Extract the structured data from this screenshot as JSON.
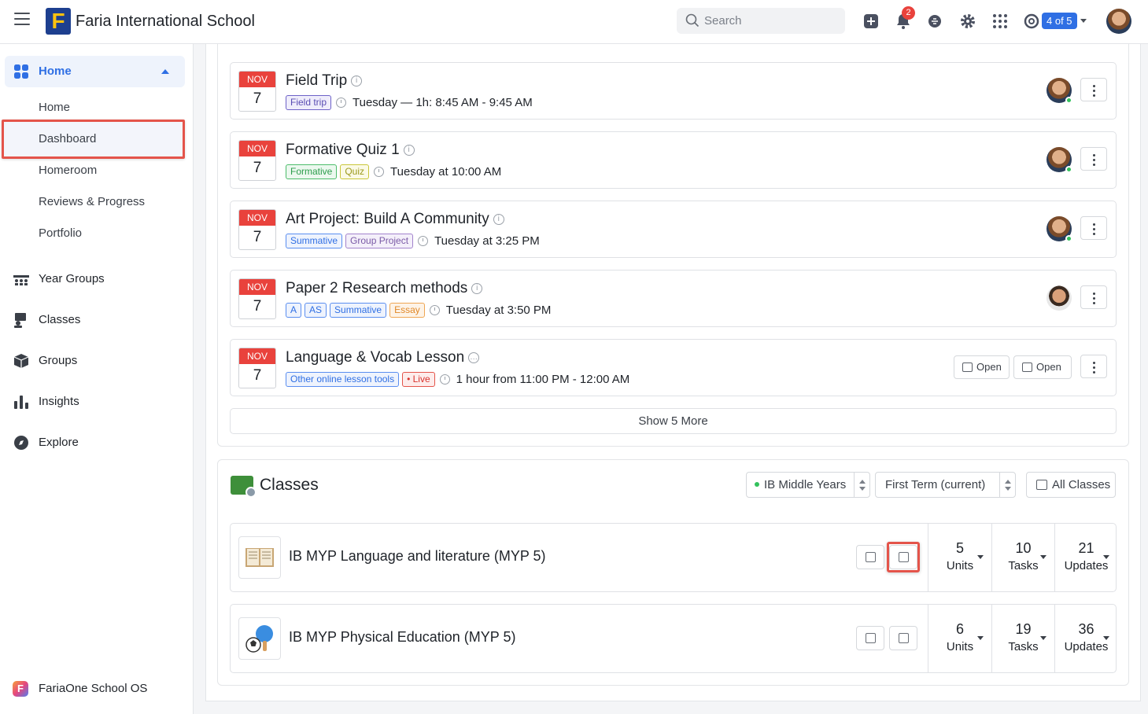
{
  "topbar": {
    "school_name": "Faria International School",
    "logo_letter": "F",
    "search_placeholder": "Search",
    "notification_count": "2",
    "pagination_pill": "4 of 5"
  },
  "sidebar": {
    "home_label": "Home",
    "sub_items": [
      "Home",
      "Dashboard",
      "Homeroom",
      "Reviews & Progress",
      "Portfolio"
    ],
    "nav_items": [
      {
        "label": "Year Groups",
        "icon": "year-groups-icon"
      },
      {
        "label": "Classes",
        "icon": "classes-icon"
      },
      {
        "label": "Groups",
        "icon": "groups-icon"
      },
      {
        "label": "Insights",
        "icon": "insights-icon"
      },
      {
        "label": "Explore",
        "icon": "explore-icon"
      }
    ],
    "footer_label": "FariaOne School OS"
  },
  "events": [
    {
      "month": "NOV",
      "day": "7",
      "title": "Field Trip",
      "tags": [
        {
          "text": "Field trip",
          "color": "purple"
        }
      ],
      "time": "Tuesday — 1h: 8:45 AM - 9:45 AM"
    },
    {
      "month": "NOV",
      "day": "7",
      "title": "Formative Quiz 1",
      "tags": [
        {
          "text": "Formative",
          "color": "green"
        },
        {
          "text": "Quiz",
          "color": "yellow"
        }
      ],
      "time": "Tuesday at 10:00 AM"
    },
    {
      "month": "NOV",
      "day": "7",
      "title": "Art Project: Build A Community",
      "tags": [
        {
          "text": "Summative",
          "color": "blue"
        },
        {
          "text": "Group Project",
          "color": "violet"
        }
      ],
      "time": "Tuesday at 3:25 PM"
    },
    {
      "month": "NOV",
      "day": "7",
      "title": "Paper 2 Research methods",
      "tags": [
        {
          "text": "A",
          "color": "blue"
        },
        {
          "text": "AS",
          "color": "blue"
        },
        {
          "text": "Summative",
          "color": "blue"
        },
        {
          "text": "Essay",
          "color": "orange"
        }
      ],
      "time": "Tuesday at 3:50 PM"
    },
    {
      "month": "NOV",
      "day": "7",
      "title": "Language & Vocab Lesson",
      "tags": [
        {
          "text": "Other online lesson tools",
          "color": "blue"
        },
        {
          "text": "• Live",
          "color": "red"
        }
      ],
      "time": "1 hour from 11:00 PM - 12:00 AM"
    }
  ],
  "open_buttons": [
    "Open",
    "Open"
  ],
  "show_more": "Show 5 More",
  "classes": {
    "title": "Classes",
    "program_select": "IB Middle Years",
    "term_select": "First Term (current)",
    "all_classes": "All Classes",
    "rows": [
      {
        "name": "IB MYP Language and literature (MYP 5)",
        "units": "5",
        "units_label": "Units",
        "tasks": "10",
        "tasks_label": "Tasks",
        "updates": "21",
        "updates_label": "Updates"
      },
      {
        "name": "IB MYP Physical Education (MYP 5)",
        "units": "6",
        "units_label": "Units",
        "tasks": "19",
        "tasks_label": "Tasks",
        "updates": "36",
        "updates_label": "Updates"
      }
    ]
  }
}
